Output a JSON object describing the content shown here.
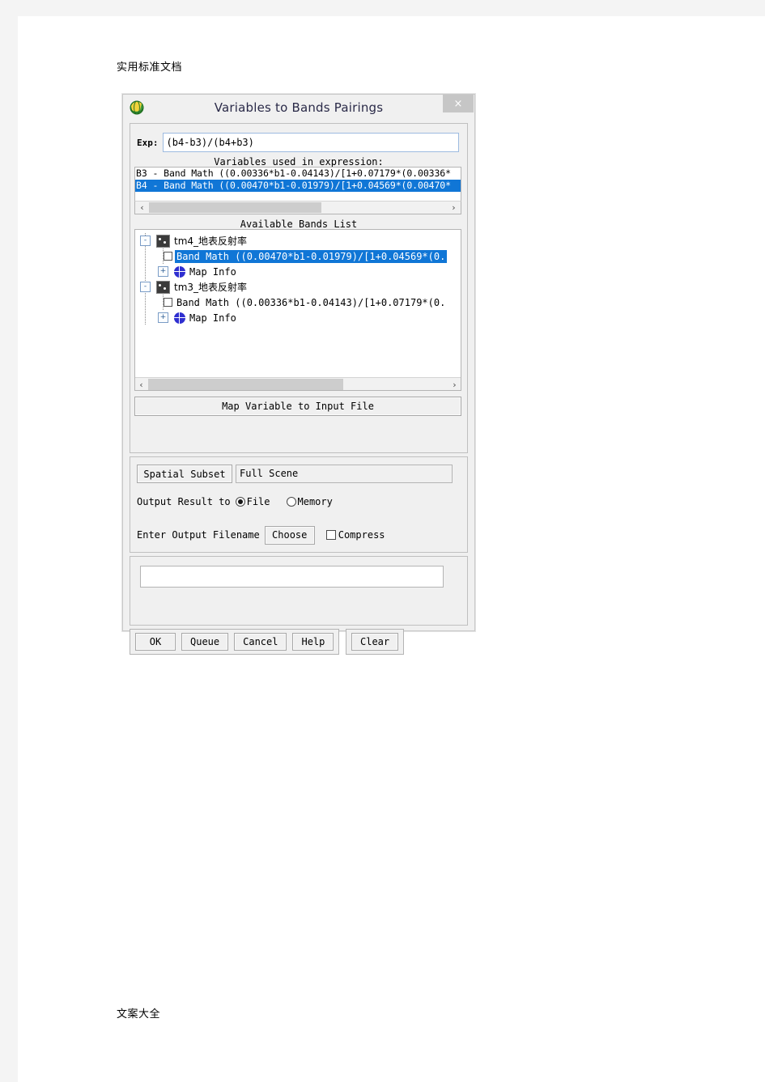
{
  "document": {
    "header_text": "实用标准文档",
    "footer_text": "文案大全"
  },
  "dialog": {
    "title": "Variables to Bands Pairings",
    "app_icon": "envi-globe-icon",
    "close_label": "×",
    "expression": {
      "label": "Exp:",
      "value": "(b4-b3)/(b4+b3)",
      "placeholder": ""
    },
    "variables_section": {
      "caption": "Variables used in expression:",
      "rows": [
        {
          "text": "B3 - Band Math ((0.00336*b1-0.04143)/[1+0.07179*(0.00336*",
          "selected": false
        },
        {
          "text": "B4 - Band Math ((0.00470*b1-0.01979)/[1+0.04569*(0.00470*",
          "selected": true
        }
      ],
      "scrollbar": {
        "left_arrow": "‹",
        "right_arrow": "›",
        "thumb_left_pct": 0,
        "thumb_width_pct": 58
      }
    },
    "bands_section": {
      "caption": "Available Bands List",
      "tree": [
        {
          "level": 1,
          "expander": "-",
          "icon": "raster-icon",
          "label": "tm4_地表反射率",
          "cjk": true,
          "selected": false
        },
        {
          "level": 2,
          "expander": "",
          "icon": "leaf-icon",
          "label": "Band Math ((0.00470*b1-0.01979)/[1+0.04569*(0.",
          "cjk": false,
          "selected": true
        },
        {
          "level": 2,
          "expander": "+",
          "icon": "globe-icon",
          "label": "Map Info",
          "cjk": false,
          "selected": false
        },
        {
          "level": 1,
          "expander": "-",
          "icon": "raster-icon",
          "label": "tm3_地表反射率",
          "cjk": true,
          "selected": false
        },
        {
          "level": 2,
          "expander": "",
          "icon": "leaf-icon",
          "label": "Band Math ((0.00336*b1-0.04143)/[1+0.07179*(0.",
          "cjk": false,
          "selected": false
        },
        {
          "level": 2,
          "expander": "+",
          "icon": "globe-icon",
          "label": "Map Info",
          "cjk": false,
          "selected": false
        }
      ],
      "scrollbar": {
        "left_arrow": "‹",
        "right_arrow": "›",
        "thumb_left_pct": 0,
        "thumb_width_pct": 65
      }
    },
    "map_variable_button": "Map Variable to Input File",
    "spatial_subset": {
      "button_label": "Spatial Subset",
      "value": "Full Scene"
    },
    "output_result": {
      "label": "Output Result to",
      "options": [
        {
          "label": "File",
          "selected": true
        },
        {
          "label": "Memory",
          "selected": false
        }
      ]
    },
    "output_filename": {
      "label": "Enter Output Filename",
      "choose_label": "Choose",
      "compress_label": "Compress",
      "compress_checked": false,
      "value": "",
      "placeholder": ""
    },
    "action_buttons": {
      "left_group": [
        "OK",
        "Queue",
        "Cancel",
        "Help"
      ],
      "right_group": [
        "Clear"
      ]
    }
  },
  "colors": {
    "selection_blue": "#1076d6",
    "dialog_face": "#f0f0f0",
    "page_background": "#ffffff",
    "canvas_background": "#f4f4f4",
    "title_text": "#2a2a48"
  }
}
